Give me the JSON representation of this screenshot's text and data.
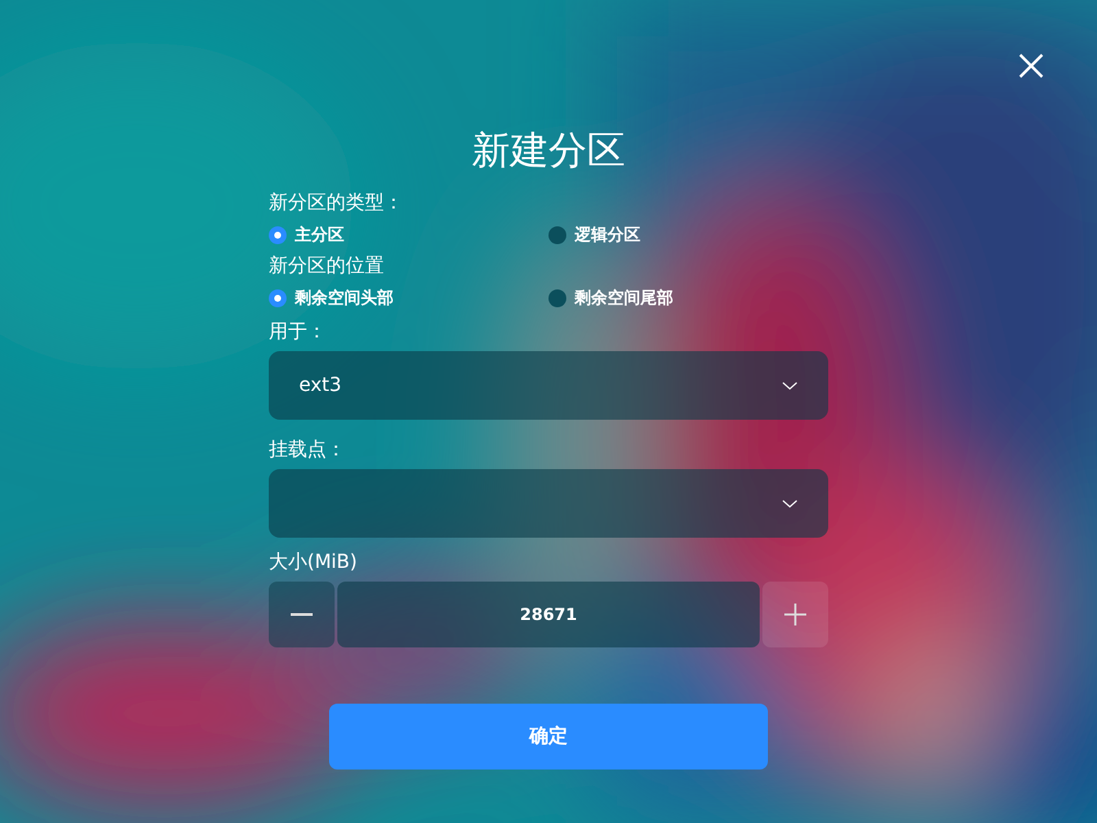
{
  "title": "新建分区",
  "radio_groups": [
    {
      "label": "新分区的类型：",
      "options": [
        {
          "label": "主分区",
          "selected": true
        },
        {
          "label": "逻辑分区",
          "selected": false
        }
      ]
    },
    {
      "label": "新分区的位置",
      "options": [
        {
          "label": "剩余空间头部",
          "selected": true
        },
        {
          "label": "剩余空间尾部",
          "selected": false
        }
      ]
    }
  ],
  "filesystem": {
    "label": "用于：",
    "value": "ext3"
  },
  "mount_point": {
    "label": "挂载点："
  },
  "size": {
    "label": "大小(MiB)",
    "value": "28671"
  },
  "confirm_button": "确定"
}
